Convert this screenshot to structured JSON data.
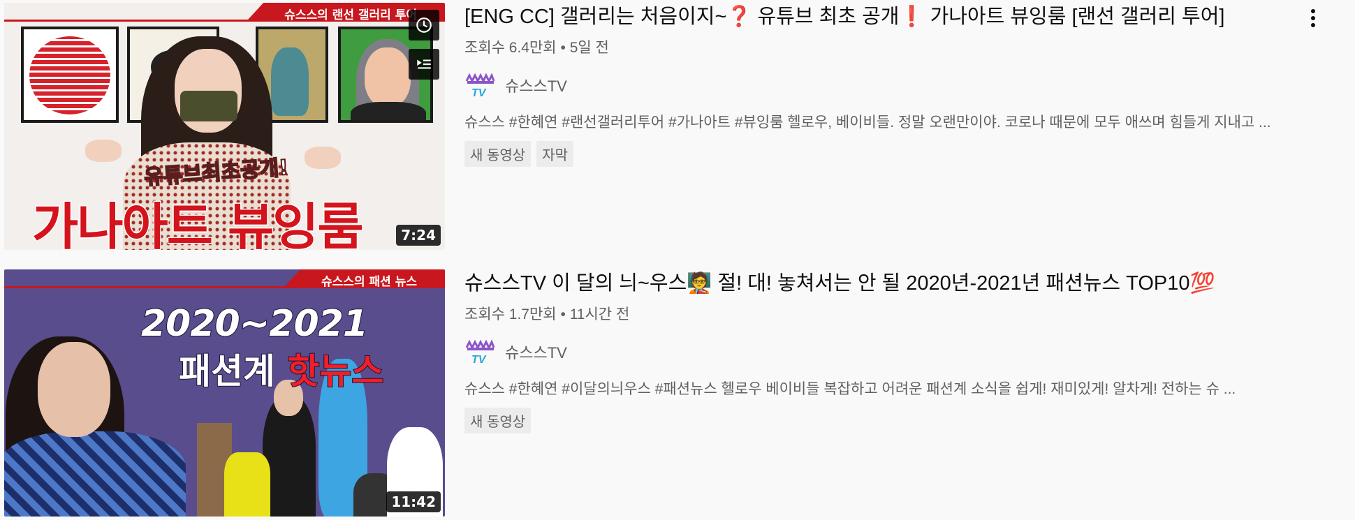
{
  "videos": [
    {
      "title": "[ENG CC] 갤러리는 처음이지~❓ 유튜브 최초 공개❗ 가나아트 뷰잉룸 [랜선 갤러리 투어]",
      "views": "조회수 6.4만회",
      "age": "5일 전",
      "channel": "슈스스TV",
      "description": "슈스스 #한혜연 #랜선갤러리투어 #가나아트 #뷰잉룸 헬로우, 베이비들. 정말 오랜만이야. 코로나 때문에 모두 애쓰며 힘들게 지내고 ...",
      "badges": [
        "새 동영상",
        "자막"
      ],
      "duration": "7:24",
      "thumbnail": {
        "banner": "슈스스의 랜선 갤러리 투어",
        "subtitle": "유튜브최초공개!",
        "headline": "가나아트 뷰잉룸"
      }
    },
    {
      "title": "슈스스TV 이 달의 늬~우스🧑‍🏫 절! 대! 놓쳐서는 안 될 2020년-2021년 패션뉴스 TOP10💯",
      "views": "조회수 1.7만회",
      "age": "11시간 전",
      "channel": "슈스스TV",
      "description": "슈스스 #한혜연 #이달의늬우스 #패션뉴스 헬로우 베이비들 복잡하고 어려운 패션계 소식을 쉽게! 재미있게! 알차게! 전하는 슈 ...",
      "badges": [
        "새 동영상"
      ],
      "duration": "11:42",
      "thumbnail": {
        "banner": "슈스스의 패션 뉴스",
        "line1": "2020~2021",
        "line2a": "패션계 ",
        "line2b": "핫뉴스"
      }
    }
  ],
  "separator": "•",
  "icons": {
    "watch_later": "clock-icon",
    "add_to_queue": "queue-icon",
    "more": "more-vert-icon"
  },
  "colors": {
    "banner_red": "#c8171e",
    "meta_gray": "#606060",
    "badge_bg": "#ececec"
  }
}
